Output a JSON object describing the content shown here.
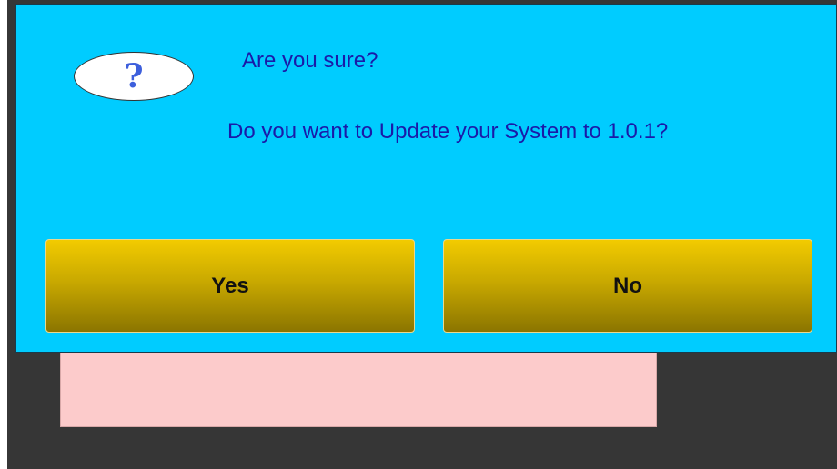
{
  "dialog": {
    "icon": "question-icon",
    "icon_glyph": "?",
    "title": "Are you sure?",
    "message": "Do you want to Update your System to 1.0.1?",
    "buttons": {
      "yes_label": "Yes",
      "no_label": "No"
    }
  },
  "colors": {
    "dialog_background": "#00ccff",
    "text": "#1a1aa8",
    "button_top": "#f2cb00",
    "button_bottom": "#8b7500",
    "screen_background": "#363636",
    "underlying_panel": "#fccbcb"
  }
}
